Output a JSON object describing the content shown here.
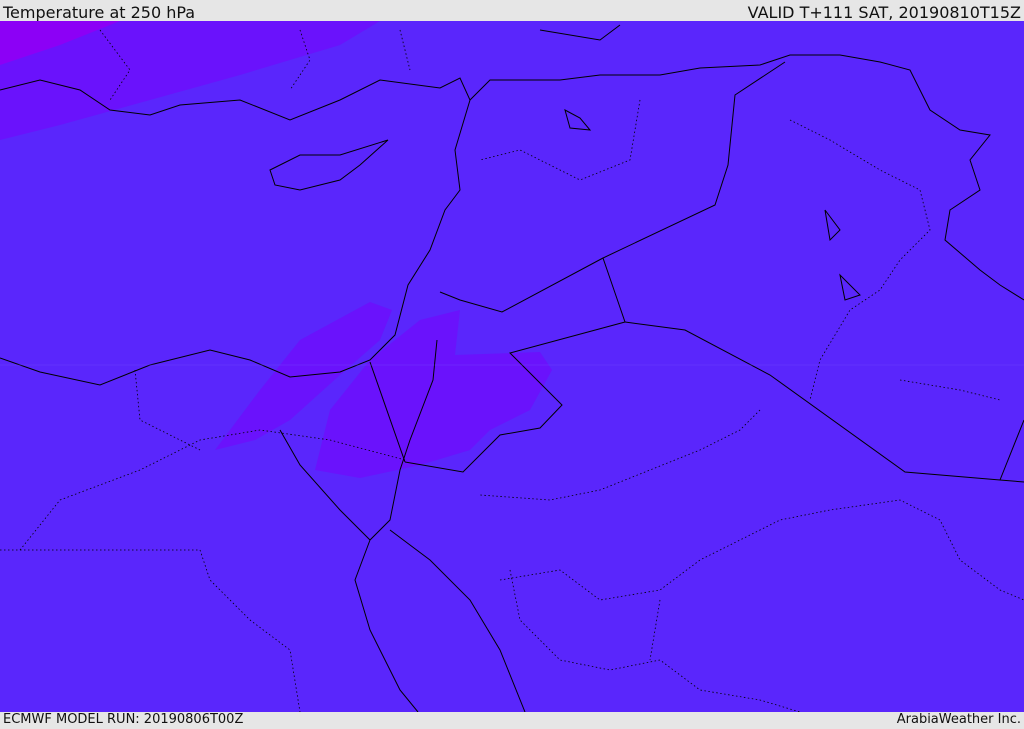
{
  "header": {
    "title": "Temperature at 250 hPa",
    "valid": "VALID T+111 SAT, 20190810T15Z"
  },
  "footer": {
    "model_run": "ECMWF MODEL RUN: 20190806T00Z",
    "credit": "ArabiaWeather Inc."
  },
  "colors": {
    "base": "#5a26fc",
    "warm1": "#6a12fc",
    "warm2": "#7e04fa",
    "warm3": "#8c00f6",
    "coast": "#000000"
  }
}
